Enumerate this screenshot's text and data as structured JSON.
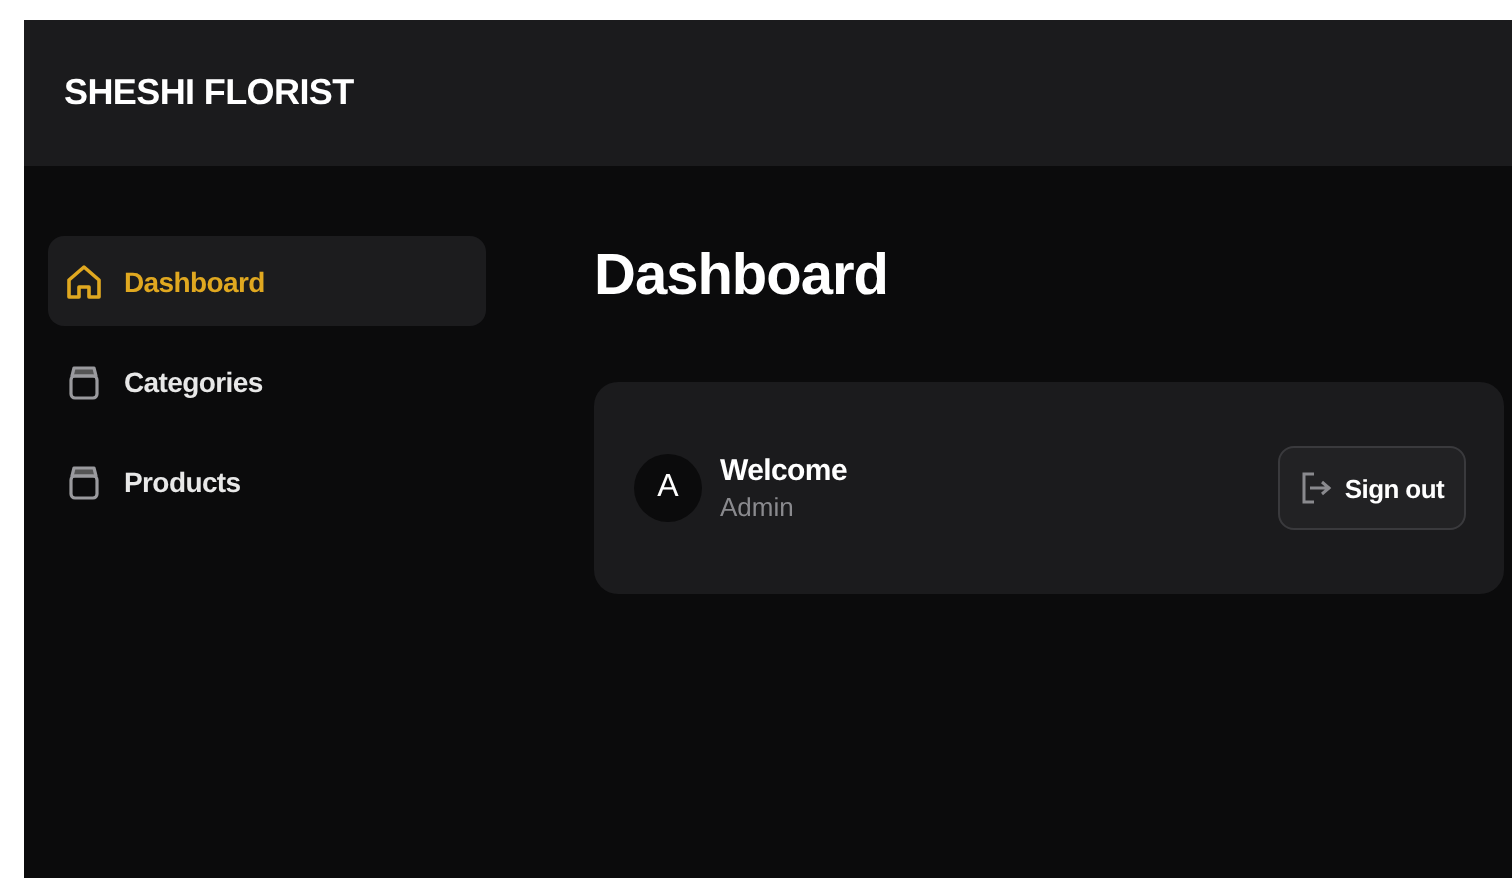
{
  "header": {
    "brand": "SHESHI FLORIST"
  },
  "sidebar": {
    "items": [
      {
        "label": "Dashboard",
        "kind": "home",
        "selected": true
      },
      {
        "label": "Categories",
        "kind": "box",
        "selected": false
      },
      {
        "label": "Products",
        "kind": "box",
        "selected": false
      }
    ]
  },
  "main": {
    "title": "Dashboard",
    "card": {
      "avatar": "A",
      "welcome": "Welcome",
      "role": "Admin",
      "button": "Sign out"
    }
  }
}
